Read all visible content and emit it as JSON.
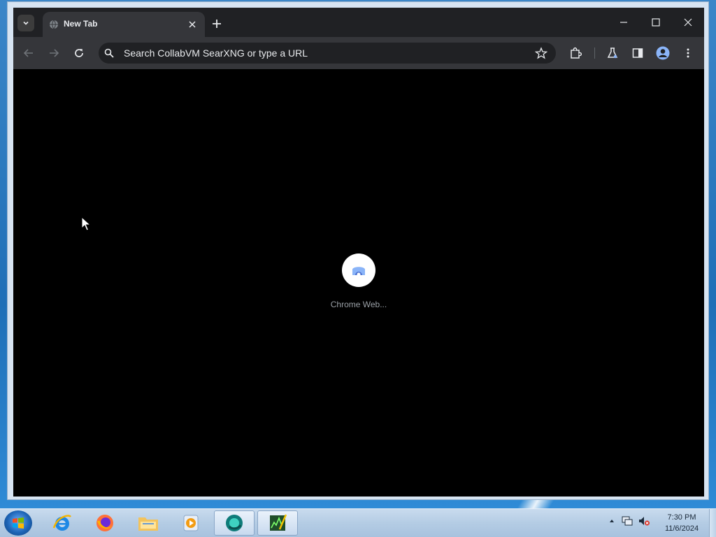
{
  "browser": {
    "tab": {
      "title": "New Tab"
    },
    "omnibox": {
      "placeholder": "Search CollabVM SearXNG or type a URL"
    },
    "shortcut_tile": {
      "label": "Chrome Web..."
    }
  },
  "icons": {
    "tab_search": "chevron-down-icon",
    "tab_favicon": "globe-icon",
    "tab_close": "close-icon",
    "new_tab": "plus-icon",
    "back": "arrow-left-icon",
    "forward": "arrow-right-icon",
    "reload": "reload-icon",
    "bookmark": "star-icon",
    "extensions": "puzzle-icon",
    "labs": "flask-icon",
    "side_panel": "side-panel-icon",
    "profile": "avatar-icon",
    "menu": "kebab-icon"
  },
  "taskbar": {
    "items": [
      "internet-explorer",
      "firefox",
      "file-explorer",
      "media-player",
      "webview",
      "task-manager"
    ],
    "clock": {
      "time": "7:30 PM",
      "date": "11/6/2024"
    }
  },
  "colors": {
    "chrome_dark": "#202124",
    "toolbar": "#35363a",
    "text": "#e8eaed",
    "muted": "#9aa0a6",
    "taskbar": "#b4cce4"
  }
}
